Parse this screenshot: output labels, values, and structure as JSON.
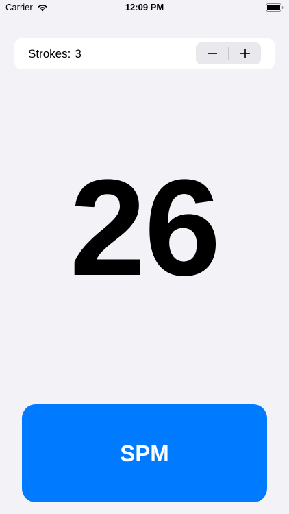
{
  "status_bar": {
    "carrier": "Carrier",
    "time": "12:09 PM",
    "icons": [
      "wifi-icon",
      "battery-icon"
    ]
  },
  "strokes": {
    "label": "Strokes:",
    "value": "3",
    "decrement_icon": "minus-icon",
    "increment_icon": "plus-icon"
  },
  "display": {
    "spm_value": "26"
  },
  "action": {
    "button_label": "SPM"
  },
  "colors": {
    "background": "#F2F2F7",
    "card": "#FFFFFF",
    "stepper": "#E8E8ED",
    "accent": "#007AFF",
    "text": "#000000"
  }
}
